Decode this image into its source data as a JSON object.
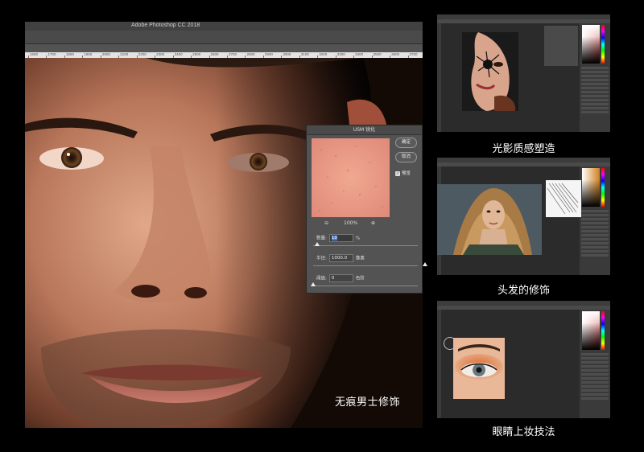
{
  "main_window": {
    "title": "Adobe Photoshop CC 2018",
    "ruler_labels": [
      "1600",
      "1700",
      "1800",
      "1900",
      "2000",
      "2100",
      "2200",
      "2300",
      "2400",
      "2500",
      "2600",
      "2700",
      "2800",
      "2900",
      "3000",
      "3100",
      "3200",
      "3300",
      "3400",
      "3500",
      "3600",
      "3700"
    ],
    "caption": "无痕男士修饰"
  },
  "usm_dialog": {
    "title": "USM 锐化",
    "ok_label": "确定",
    "cancel_label": "取消",
    "preview_label": "预览",
    "preview_checked": true,
    "zoom_out_icon": "zoom-out-icon",
    "zoom_in_icon": "zoom-in-icon",
    "zoom_level": "100%",
    "amount_label": "数量:",
    "amount_value": "10",
    "amount_unit": "%",
    "radius_label": "半径:",
    "radius_value": "1000.0",
    "radius_unit": "像素",
    "threshold_label": "阈值:",
    "threshold_value": "0",
    "threshold_unit": "色阶"
  },
  "thumbnails": [
    {
      "caption": "光影质感塑造"
    },
    {
      "caption": "头发的修饰"
    },
    {
      "caption": "眼睛上妆技法"
    }
  ],
  "colors": {
    "ps_dark": "#2b2b2b",
    "ps_panel": "#3a3a3a",
    "skin": "#c98a6a",
    "dialog_bg": "#535353"
  }
}
